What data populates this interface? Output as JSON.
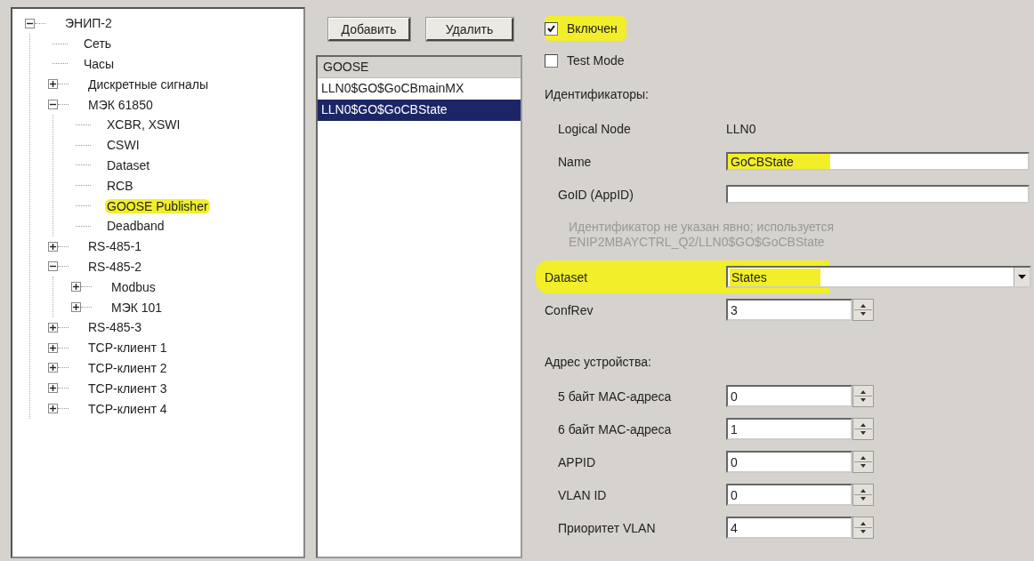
{
  "tree": [
    {
      "label": "ЭНИП-2",
      "kind": "node",
      "expanded": true,
      "highlighted": false,
      "children": [
        {
          "label": "Сеть",
          "kind": "leaf",
          "highlighted": false
        },
        {
          "label": "Часы",
          "kind": "leaf",
          "highlighted": false
        },
        {
          "label": "Дискретные сигналы",
          "kind": "node",
          "expanded": false,
          "highlighted": false
        },
        {
          "label": "МЭК 61850",
          "kind": "node",
          "expanded": true,
          "highlighted": false,
          "children": [
            {
              "label": "XCBR, XSWI",
              "kind": "leaf",
              "highlighted": false
            },
            {
              "label": "CSWI",
              "kind": "leaf",
              "highlighted": false
            },
            {
              "label": "Dataset",
              "kind": "leaf",
              "highlighted": false
            },
            {
              "label": "RCB",
              "kind": "leaf",
              "highlighted": false
            },
            {
              "label": "GOOSE Publisher",
              "kind": "leaf",
              "highlighted": true
            },
            {
              "label": "Deadband",
              "kind": "leaf",
              "highlighted": false
            }
          ]
        },
        {
          "label": "RS-485-1",
          "kind": "node",
          "expanded": false,
          "highlighted": false
        },
        {
          "label": "RS-485-2",
          "kind": "node",
          "expanded": true,
          "highlighted": false,
          "children": [
            {
              "label": "Modbus",
              "kind": "node",
              "expanded": false,
              "highlighted": false
            },
            {
              "label": "МЭК 101",
              "kind": "node",
              "expanded": false,
              "highlighted": false
            }
          ]
        },
        {
          "label": "RS-485-3",
          "kind": "node",
          "expanded": false,
          "highlighted": false
        },
        {
          "label": "TCP-клиент 1",
          "kind": "node",
          "expanded": false,
          "highlighted": false
        },
        {
          "label": "TCP-клиент 2",
          "kind": "node",
          "expanded": false,
          "highlighted": false
        },
        {
          "label": "TCP-клиент 3",
          "kind": "node",
          "expanded": false,
          "highlighted": false
        },
        {
          "label": "TCP-клиент 4",
          "kind": "node",
          "expanded": false,
          "highlighted": false
        }
      ]
    }
  ],
  "buttons": [
    "Добавить",
    "Удалить"
  ],
  "goose_list": {
    "header": "GOOSE",
    "items": [
      {
        "label": "LLN0$GO$GoCBmainMX",
        "selected": false
      },
      {
        "label": "LLN0$GO$GoCBState",
        "selected": true
      }
    ]
  },
  "settings": [
    {
      "kind": "checkbox",
      "label": "Включен",
      "checked": true,
      "highlighted": true
    },
    {
      "kind": "checkbox",
      "label": "Test Mode",
      "checked": false,
      "highlighted": false
    },
    {
      "kind": "group",
      "title": "Идентификаторы:",
      "fields": [
        {
          "kind": "readonly",
          "label": "Logical Node",
          "value": "LLN0"
        },
        {
          "kind": "text",
          "label": "Name",
          "value": "GoCBState",
          "highlighted": true
        },
        {
          "kind": "text",
          "label": "GoID (AppID)",
          "highlighted": false
        },
        {
          "kind": "hint",
          "lines": [
            "Идентификатор не указан явно; используется",
            "ENIP2MBAYCTRL_Q2/LLN0$GO$GoCBState"
          ]
        }
      ]
    },
    {
      "kind": "combo",
      "label": "Dataset",
      "value": "States",
      "highlighted": true
    },
    {
      "kind": "spin",
      "label": "ConfRev",
      "value": "3"
    },
    {
      "kind": "group",
      "title": "Адрес устройства:",
      "fields": [
        {
          "kind": "spin",
          "label": "5 байт MAC-адреса",
          "value": "0"
        },
        {
          "kind": "spin",
          "label": "6 байт MAC-адреса",
          "value": "1"
        },
        {
          "kind": "spin",
          "label": "APPID",
          "value": "0"
        },
        {
          "kind": "spin",
          "label": "VLAN ID",
          "value": "0"
        },
        {
          "kind": "spin",
          "label": "Приоритет VLAN",
          "value": "4"
        }
      ]
    }
  ]
}
